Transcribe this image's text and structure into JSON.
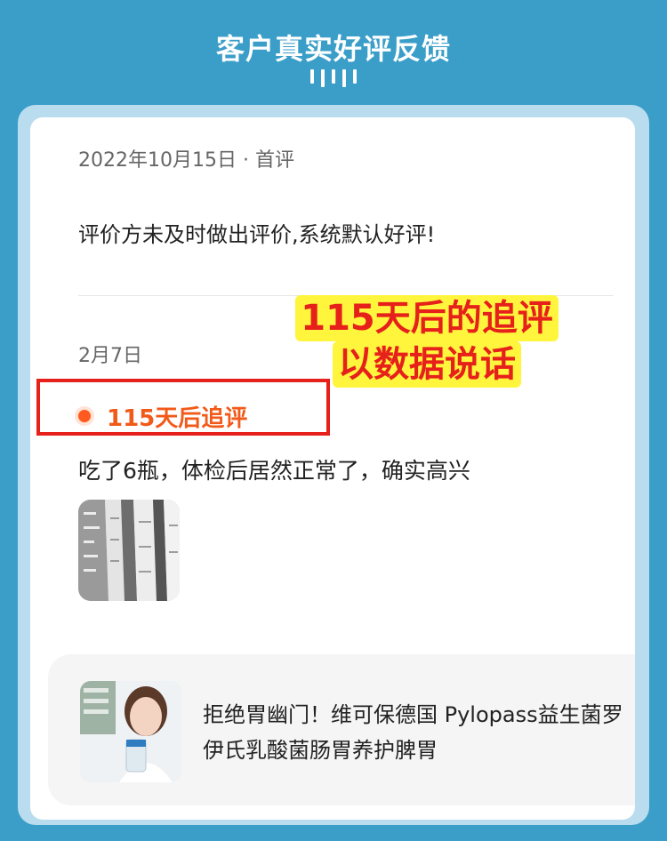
{
  "header": {
    "title": "客户真实好评反馈"
  },
  "review": {
    "date": "2022年10月15日 · 首评",
    "text": "评价方未及时做出评价,系统默认好评!",
    "followup_date": "2月7日",
    "followup_label": "115天后追评",
    "followup_text": "吃了6瓶，体检后居然正常了，确实高兴"
  },
  "annotation": {
    "line1": "115天后的追评",
    "line2": "以数据说话"
  },
  "product": {
    "title": "拒绝胃幽门！维可保德国 Pylopass益生菌罗伊氏乳酸菌肠胃养护脾胃"
  },
  "colors": {
    "background": "#3a9ec8",
    "accent_orange": "#f25a1a",
    "highlight_yellow": "#fff53d",
    "annotation_red": "#e6201a"
  }
}
